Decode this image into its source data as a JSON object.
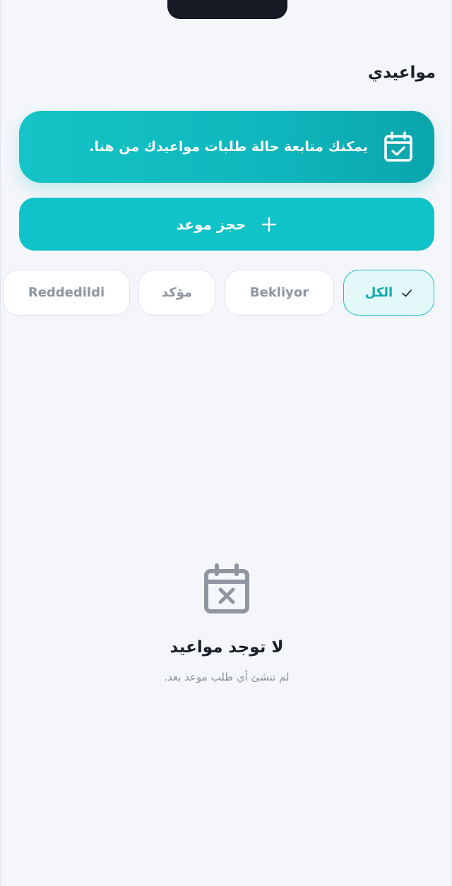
{
  "header": {
    "title": "مواعيدي"
  },
  "banner": {
    "text": "يمكنك متابعة حالة طلبات مواعيدك من هنا.",
    "icon": "calendar-check-icon"
  },
  "book_button": {
    "label": "حجز موعد",
    "icon": "plus-icon"
  },
  "filters": [
    {
      "label": "الكل",
      "active": true,
      "icon": "check-icon"
    },
    {
      "label": "Bekliyor",
      "active": false
    },
    {
      "label": "مؤكد",
      "active": false
    },
    {
      "label": "Reddedildi",
      "active": false
    }
  ],
  "empty": {
    "icon": "calendar-x-icon",
    "title": "لا توجد مواعيد",
    "subtitle": "لم تنشئ أي طلب موعد بعد."
  },
  "colors": {
    "accent": "#10C3C8",
    "background": "#F4F6FA",
    "text_primary": "#1B1F27",
    "text_muted": "#8F969F"
  }
}
